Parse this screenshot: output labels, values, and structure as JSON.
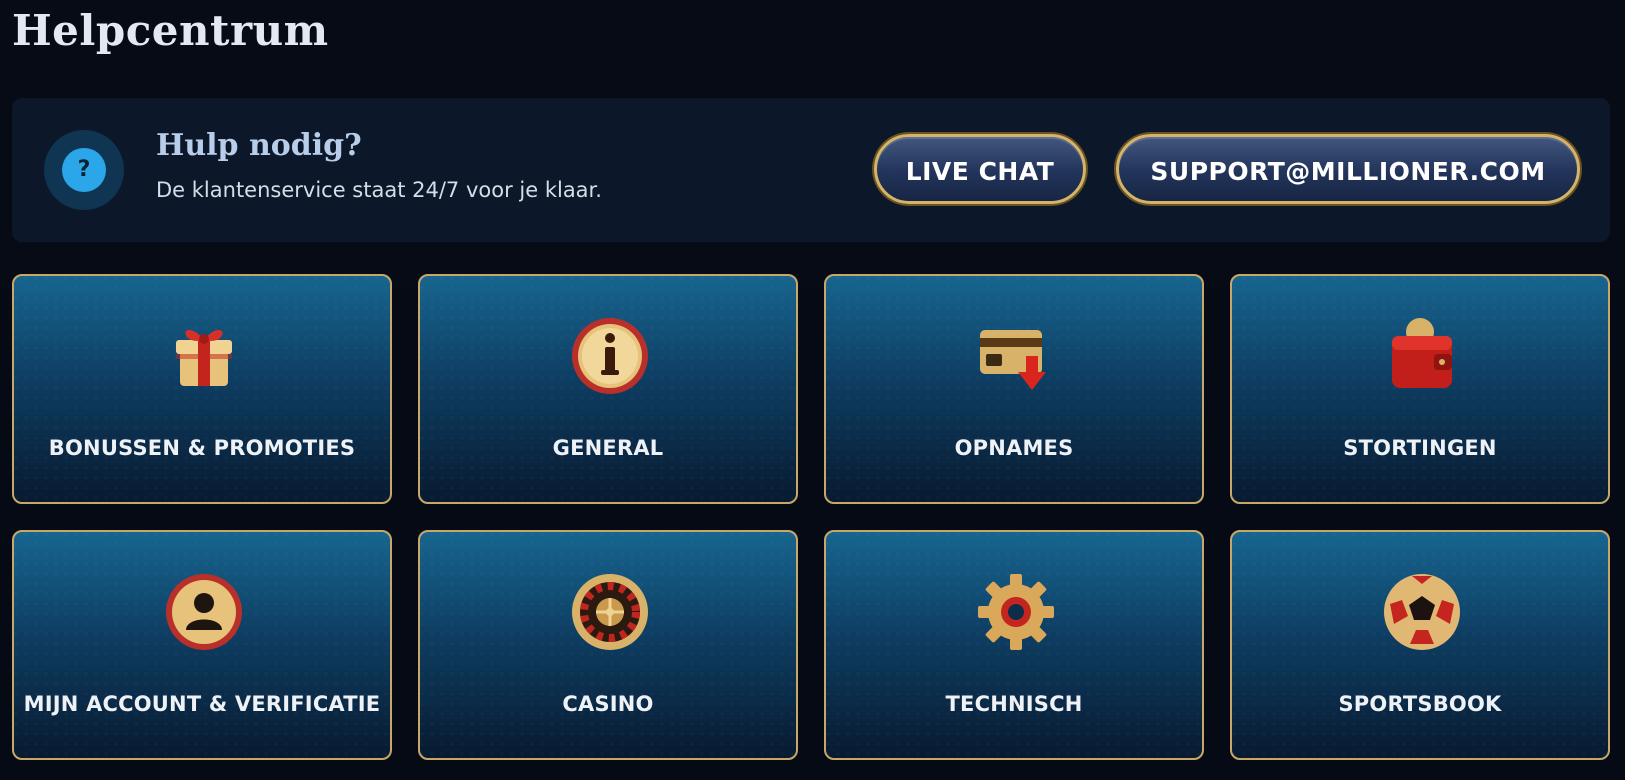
{
  "page": {
    "title": "Helpcentrum"
  },
  "help": {
    "icon": "question-icon",
    "heading": "Hulp nodig?",
    "subtext": "De klantenservice staat 24/7 voor je klaar.",
    "live_chat_label": "LIVE CHAT",
    "email_label": "SUPPORT@MILLIONER.COM"
  },
  "categories": [
    {
      "label": "BONUSSEN & PROMOTIES",
      "icon": "gift-icon"
    },
    {
      "label": "GENERAL",
      "icon": "info-icon"
    },
    {
      "label": "OPNAMES",
      "icon": "withdraw-card-icon"
    },
    {
      "label": "STORTINGEN",
      "icon": "wallet-icon"
    },
    {
      "label": "MIJN ACCOUNT & VERIFICATIE",
      "icon": "user-account-icon"
    },
    {
      "label": "CASINO",
      "icon": "roulette-icon"
    },
    {
      "label": "TECHNISCH",
      "icon": "gear-icon"
    },
    {
      "label": "SPORTSBOOK",
      "icon": "soccer-ball-icon"
    }
  ],
  "colors": {
    "background": "#050b16",
    "banner": "#0c1829",
    "accent_gold": "#d4b46a",
    "button_blue": "#22345a",
    "card_blue": "#17658f",
    "help_icon_blue": "#2aa6e9"
  }
}
